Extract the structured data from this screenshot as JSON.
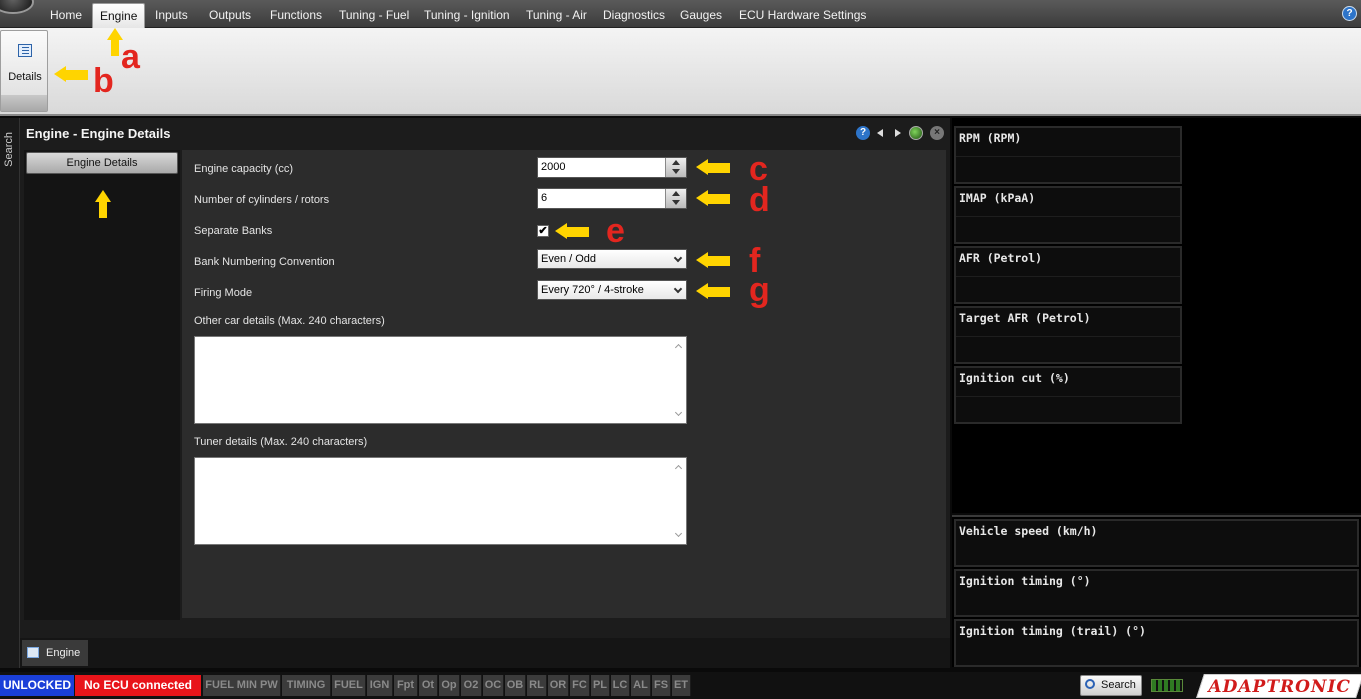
{
  "menu": {
    "tabs": [
      {
        "label": "Home",
        "active": false
      },
      {
        "label": "Engine",
        "active": true
      },
      {
        "label": "Inputs",
        "active": false
      },
      {
        "label": "Outputs",
        "active": false
      },
      {
        "label": "Functions",
        "active": false
      },
      {
        "label": "Tuning - Fuel",
        "active": false
      },
      {
        "label": "Tuning - Ignition",
        "active": false
      },
      {
        "label": "Tuning - Air",
        "active": false
      },
      {
        "label": "Diagnostics",
        "active": false
      },
      {
        "label": "Gauges",
        "active": false
      },
      {
        "label": "ECU Hardware Settings",
        "active": false
      }
    ],
    "help_glyph": "?"
  },
  "ribbon": {
    "details_label": "Details"
  },
  "side_strip": {
    "label": "Search"
  },
  "panel": {
    "title": "Engine - Engine Details",
    "help_glyph": "?",
    "close_glyph": "×",
    "nav_items": [
      "Engine Details"
    ]
  },
  "form": {
    "engine_capacity": {
      "label": "Engine capacity (cc)",
      "value": "2000"
    },
    "cylinders": {
      "label": "Number of cylinders / rotors",
      "value": "6"
    },
    "separate_banks": {
      "label": "Separate Banks",
      "checked": true,
      "check_glyph": "✔"
    },
    "bank_numbering": {
      "label": "Bank Numbering Convention",
      "value": "Even / Odd"
    },
    "firing_mode": {
      "label": "Firing Mode",
      "value": "Every 720° / 4-stroke"
    },
    "other_car_details": {
      "label": "Other car details (Max. 240 characters)",
      "value": ""
    },
    "tuner_details": {
      "label": "Tuner details (Max. 240 characters)",
      "value": ""
    }
  },
  "annotations": [
    "a",
    "b",
    "c",
    "d",
    "e",
    "f",
    "g"
  ],
  "bottom_tab": {
    "label": "Engine"
  },
  "gauges_top": [
    "RPM (RPM)",
    "IMAP  (kPaA)",
    "AFR (Petrol)",
    "Target AFR (Petrol)",
    "Ignition cut (%)"
  ],
  "gauges_bottom": [
    "Vehicle speed (km/h)",
    "Ignition timing (°)",
    "Ignition timing (trail) (°)"
  ],
  "status": {
    "unlocked": "UNLOCKED",
    "connection": "No ECU connected",
    "flags": [
      "FUEL MIN PW",
      "TIMING",
      "FUEL",
      "IGN",
      "Fpt",
      "Ot",
      "Op",
      "O2",
      "OC",
      "OB",
      "RL",
      "OR",
      "FC",
      "PL",
      "LC",
      "AL",
      "FS",
      "ET"
    ],
    "search_label": "Search",
    "colors": {
      "unlocked": "#1a3fd8",
      "no_ecu": "#e8141a"
    }
  },
  "brand": {
    "logo_text": "ADAPTRONIC"
  }
}
